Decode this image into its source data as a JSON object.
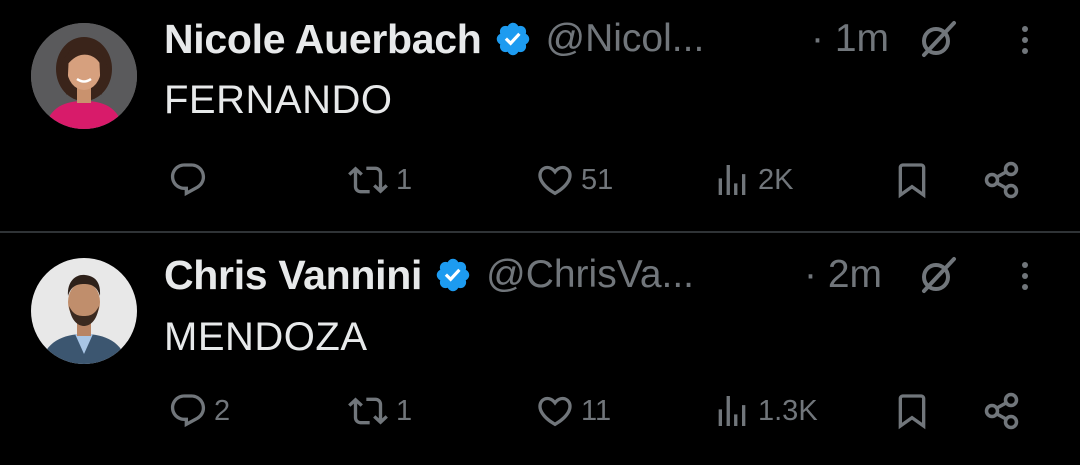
{
  "colors": {
    "background": "#000000",
    "primary_text": "#e7e9ea",
    "secondary_text": "#71767b",
    "verified_blue": "#1d9bf0",
    "divider": "#2f3336"
  },
  "tweets": [
    {
      "author": {
        "name": "Nicole Auerbach",
        "handle": "@Nicol...",
        "verified": true,
        "avatar": "avatar-woman-pink-top"
      },
      "time": "· 1m",
      "text": "FERNANDO",
      "actions": {
        "reply": "",
        "retweet": "1",
        "like": "51",
        "views": "2K"
      }
    },
    {
      "author": {
        "name": "Chris Vannini",
        "handle": "@ChrisVa...",
        "verified": true,
        "avatar": "avatar-man-blue-suit"
      },
      "time": "· 2m",
      "text": "MENDOZA",
      "actions": {
        "reply": "2",
        "retweet": "1",
        "like": "11",
        "views": "1.3K"
      }
    }
  ],
  "icons": {
    "reply": "reply-icon",
    "retweet": "retweet-icon",
    "like": "heart-icon",
    "views": "views-icon",
    "bookmark": "bookmark-icon",
    "share": "share-icon",
    "grok": "grok-icon",
    "more": "more-icon",
    "verified": "verified-badge-icon"
  }
}
